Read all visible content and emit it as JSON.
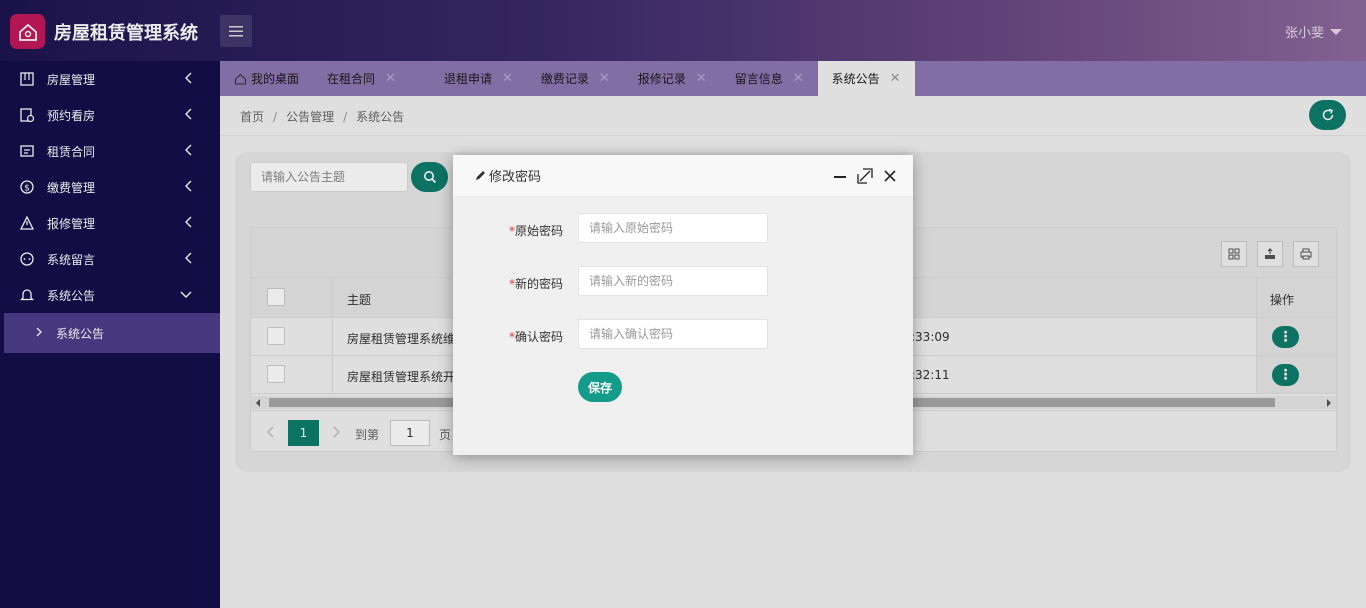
{
  "app": {
    "title": "房屋租赁管理系统",
    "user": "张小斐"
  },
  "sidebar": {
    "items": [
      {
        "label": "房屋管理",
        "icon": "building-icon"
      },
      {
        "label": "预约看房",
        "icon": "calendar-clock-icon"
      },
      {
        "label": "租赁合同",
        "icon": "contract-icon"
      },
      {
        "label": "缴费管理",
        "icon": "dollar-icon"
      },
      {
        "label": "报修管理",
        "icon": "warning-icon"
      },
      {
        "label": "系统留言",
        "icon": "message-icon"
      },
      {
        "label": "系统公告",
        "icon": "bell-icon"
      }
    ],
    "sub_item": "系统公告"
  },
  "tabs": [
    {
      "label": "我的桌面"
    },
    {
      "label": "在租合同"
    },
    {
      "label": "退租申请"
    },
    {
      "label": "缴费记录"
    },
    {
      "label": "报修记录"
    },
    {
      "label": "留言信息"
    },
    {
      "label": "系统公告"
    }
  ],
  "breadcrumb": {
    "home": "首页",
    "section": "公告管理",
    "current": "系统公告"
  },
  "search": {
    "placeholder": "请输入公告主题"
  },
  "table": {
    "headers": {
      "subject": "主题",
      "actions": "操作"
    },
    "rows": [
      {
        "subject": "房屋租赁管理系统维",
        "time": ":33:09"
      },
      {
        "subject": "房屋租赁管理系统开",
        "time": ":32:11"
      }
    ]
  },
  "pagination": {
    "current": "1",
    "goto_label": "到第",
    "goto_value": "1",
    "page_label": "页"
  },
  "modal": {
    "title": "修改密码",
    "fields": [
      {
        "label": "原始密码",
        "placeholder": "请输入原始密码"
      },
      {
        "label": "新的密码",
        "placeholder": "请输入新的密码"
      },
      {
        "label": "确认密码",
        "placeholder": "请输入确认密码"
      }
    ],
    "required_mark": "*",
    "save_label": "保存"
  },
  "colors": {
    "accent": "#0e7c6b",
    "sidebar": "#140f4a",
    "header_start": "#1d1550",
    "header_end": "#8e6a9e",
    "tabs": "#8e78b4"
  }
}
